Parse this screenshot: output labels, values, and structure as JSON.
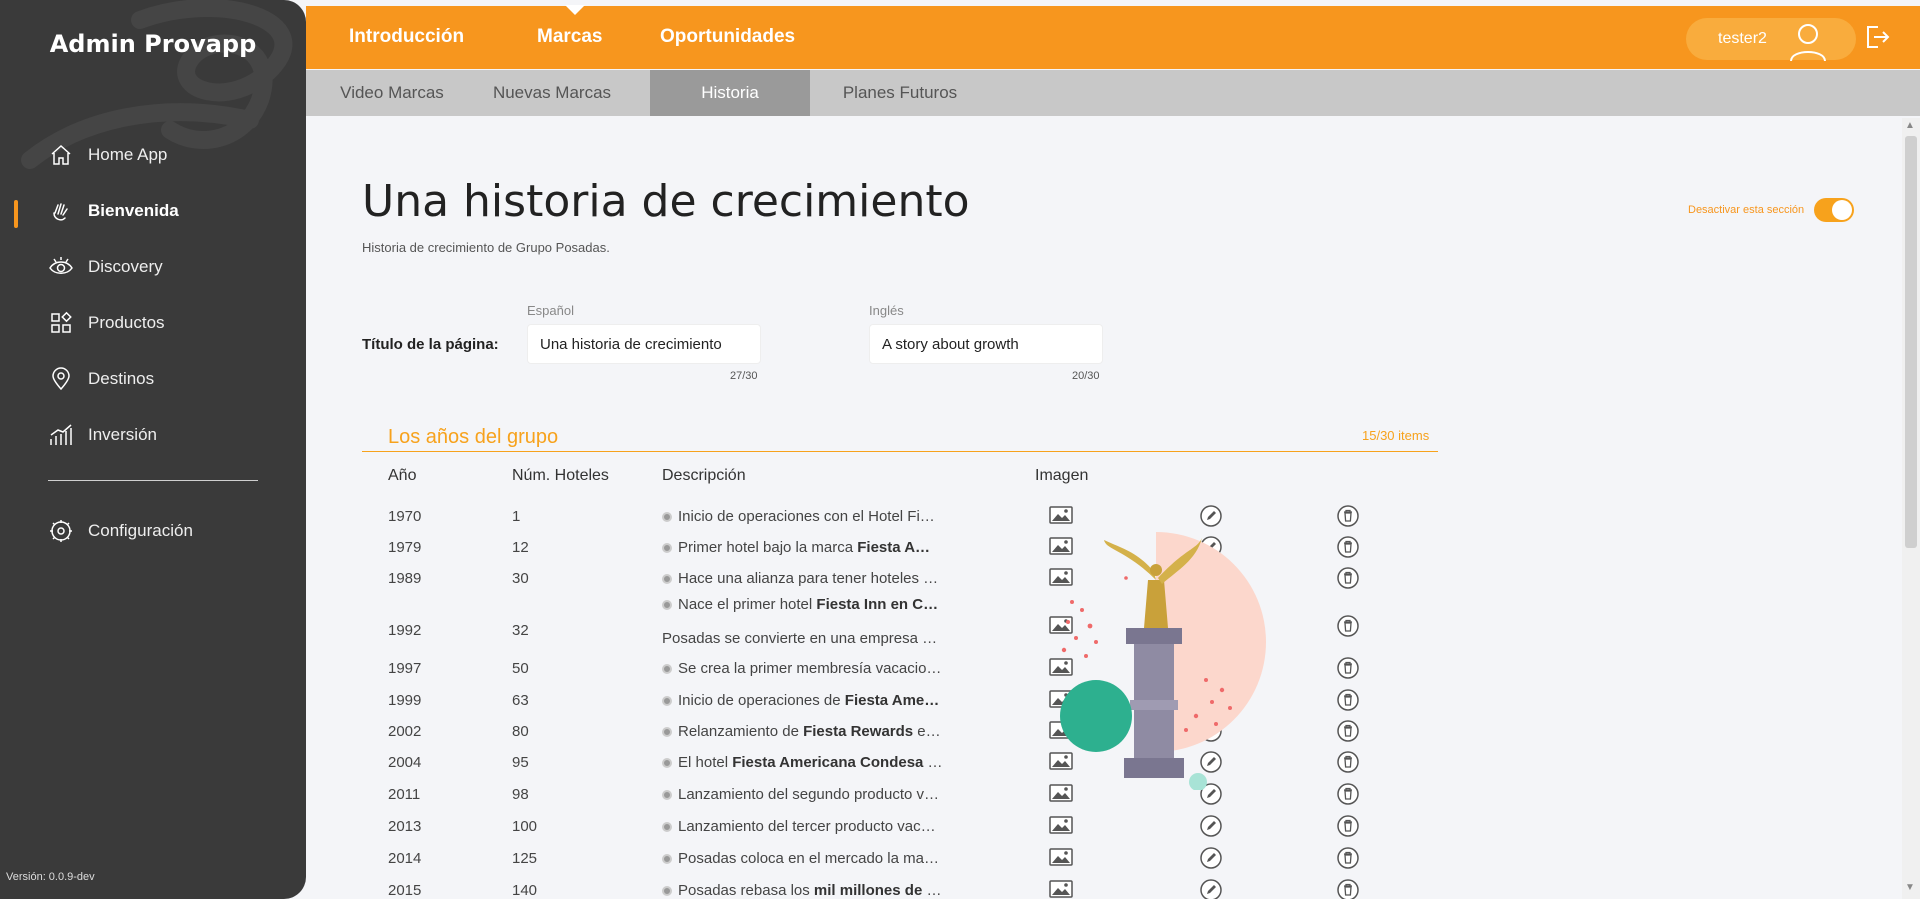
{
  "sidebar": {
    "brand": "Admin Provapp",
    "items": [
      {
        "label": "Home App",
        "icon": "home-icon"
      },
      {
        "label": "Bienvenida",
        "icon": "waving-hand-icon",
        "active": true
      },
      {
        "label": "Discovery",
        "icon": "eye-icon"
      },
      {
        "label": "Productos",
        "icon": "grid-icon"
      },
      {
        "label": "Destinos",
        "icon": "map-pin-icon"
      },
      {
        "label": "Inversión",
        "icon": "chart-icon"
      }
    ],
    "config": {
      "label": "Configuración",
      "icon": "gear-icon"
    },
    "version": "Versión: 0.0.9-dev"
  },
  "topnav": {
    "tabs": [
      "Introducción",
      "Marcas",
      "Oportunidades"
    ],
    "active": "Marcas",
    "user": "tester2"
  },
  "subnav": {
    "tabs": [
      "Video Marcas",
      "Nuevas Marcas",
      "Historia",
      "Planes Futuros"
    ],
    "active": "Historia"
  },
  "page": {
    "title": "Una historia de crecimiento",
    "subtitle": "Historia de crecimiento de Grupo Posadas.",
    "toggle_label": "Desactivar esta sección",
    "toggle_on": true
  },
  "title_field": {
    "label": "Título de la página:",
    "es_label": "Español",
    "es_value": "Una historia de crecimiento",
    "es_count": "27/30",
    "en_label": "Inglés",
    "en_value": "A story about growth",
    "en_count": "20/30"
  },
  "table": {
    "title": "Los años del grupo",
    "count": "15/30 items",
    "headers": [
      "Año",
      "Núm. Hoteles",
      "Descripción",
      "Imagen"
    ],
    "rows": [
      {
        "year": "1970",
        "hotels": "1",
        "desc": "Inicio de operaciones con el Hotel Fi…",
        "bold": ""
      },
      {
        "year": "1979",
        "hotels": "12",
        "desc": "Primer hotel bajo la marca ",
        "bold": "Fiesta A…"
      },
      {
        "year": "1989",
        "hotels": "30",
        "desc": "Hace una alianza para tener hoteles …",
        "bold": ""
      },
      {
        "year": "1992",
        "hotels": "32",
        "desc": "Nace el primer hotel ",
        "bold": "Fiesta Inn en C…",
        "desc2": "Posadas se convierte en una empresa …"
      },
      {
        "year": "1997",
        "hotels": "50",
        "desc": "Se crea la primer membresía vacacio…",
        "bold": ""
      },
      {
        "year": "1999",
        "hotels": "63",
        "desc": "Inicio de operaciones de ",
        "bold": "Fiesta Ame…"
      },
      {
        "year": "2002",
        "hotels": "80",
        "desc": "Relanzamiento de ",
        "bold": "Fiesta Rewards",
        "tail": " e…"
      },
      {
        "year": "2004",
        "hotels": "95",
        "desc": "El hotel ",
        "bold": "Fiesta Americana Condesa",
        "tail": " …"
      },
      {
        "year": "2011",
        "hotels": "98",
        "desc": "Lanzamiento del segundo producto v…",
        "bold": ""
      },
      {
        "year": "2013",
        "hotels": "100",
        "desc": "Lanzamiento del tercer producto vac…",
        "bold": ""
      },
      {
        "year": "2014",
        "hotels": "125",
        "desc": "Posadas coloca en el mercado la ma…",
        "bold": ""
      },
      {
        "year": "2015",
        "hotels": "140",
        "desc": "Posadas rebasa los ",
        "bold": "mil millones de",
        "tail": " …"
      }
    ]
  },
  "colors": {
    "accent": "#f7961e",
    "sidebar": "#3a3a3a"
  }
}
